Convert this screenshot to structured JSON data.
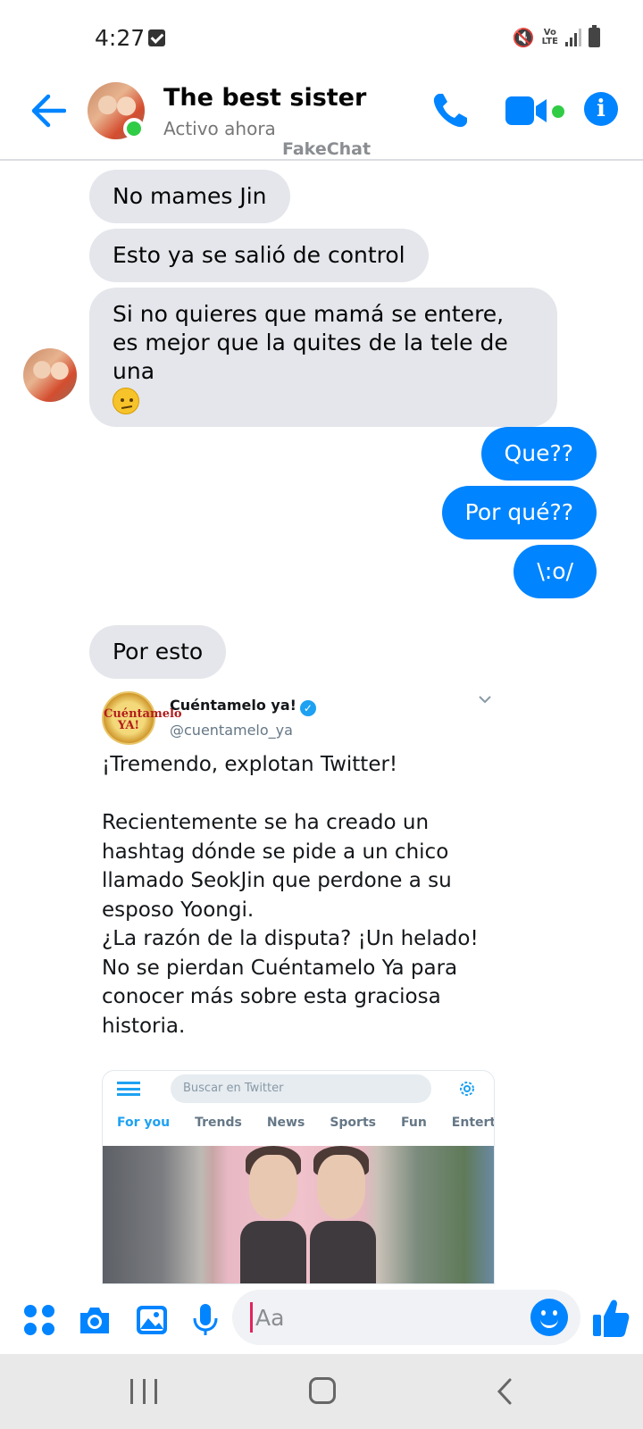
{
  "status_bar": {
    "time": "4:27",
    "volte": "Vo\nLTE"
  },
  "header": {
    "contact_name": "The best sister",
    "contact_status": "Activo ahora",
    "watermark": "FakeChat",
    "accent_color": "#0084ff",
    "online_color": "#31cc46"
  },
  "messages": [
    {
      "direction": "incoming",
      "text": "No mames Jin"
    },
    {
      "direction": "incoming",
      "text": "Esto ya se salió de control"
    },
    {
      "direction": "incoming",
      "text": "Si no quieres que mamá se entere, es mejor que la quites de la tele de una",
      "emoji": "slight-frown-emoji"
    },
    {
      "direction": "outgoing",
      "text": "Que??"
    },
    {
      "direction": "outgoing",
      "text": "Por qué??"
    },
    {
      "direction": "outgoing",
      "text": "\\:o/"
    },
    {
      "direction": "incoming",
      "text": "Por esto"
    }
  ],
  "tweet": {
    "avatar_text": "Cuéntamelo\nYA!",
    "display_name": "Cuéntamelo ya!",
    "handle": "@cuentamelo_ya",
    "verified": true,
    "text": "¡Tremendo, explotan Twitter!\n\nRecientemente se ha creado un hashtag dónde se pide a un chico llamado SeokJin que perdone a su esposo Yoongi.\n¿La razón de la disputa? ¡Un helado!\nNo se pierdan Cuéntamelo Ya para conocer más sobre esta graciosa historia.",
    "embed": {
      "search_placeholder": "Buscar en Twitter",
      "tabs": [
        "For you",
        "Trends",
        "News",
        "Sports",
        "Fun",
        "Enterta"
      ],
      "active_tab": "For you"
    }
  },
  "composer": {
    "placeholder": "Aa",
    "icons": [
      "apps-icon",
      "camera-icon",
      "gallery-icon",
      "mic-icon",
      "emoji-icon",
      "thumbs-up-icon"
    ]
  }
}
